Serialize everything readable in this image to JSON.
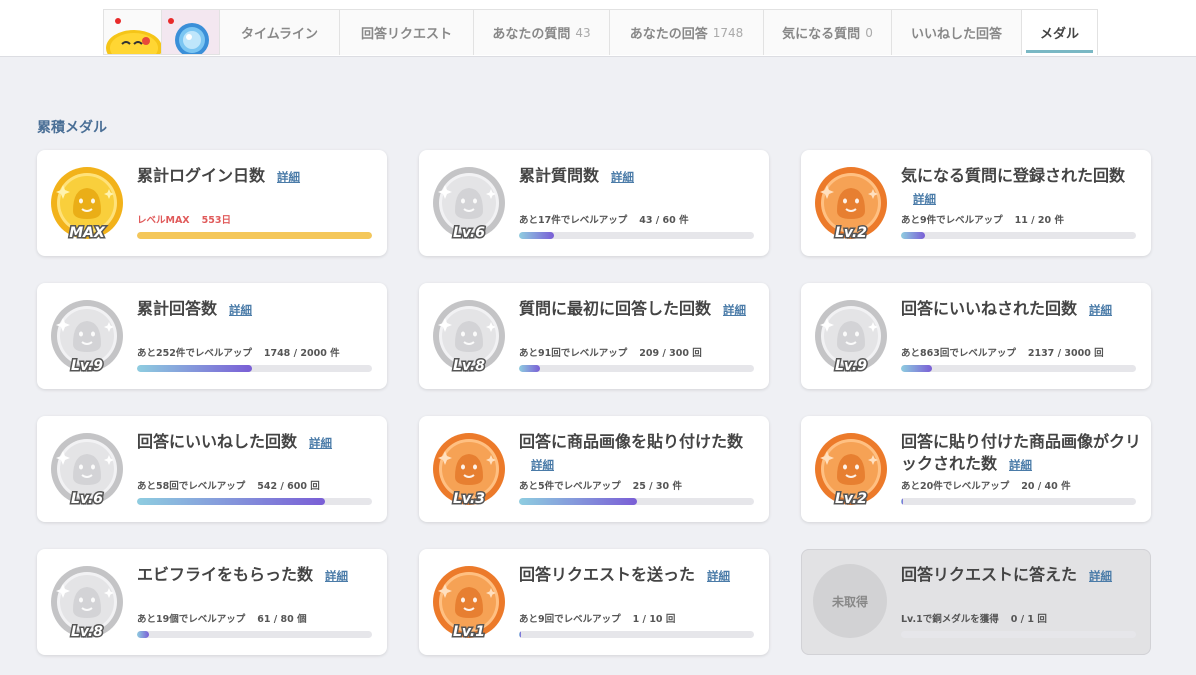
{
  "nav": {
    "avatars": [
      {
        "icon": "yellow-character-avatar"
      },
      {
        "icon": "blue-character-avatar"
      }
    ],
    "tabs": [
      {
        "label": "タイムライン",
        "count": ""
      },
      {
        "label": "回答リクエスト",
        "count": ""
      },
      {
        "label": "あなたの質問",
        "count": "43"
      },
      {
        "label": "あなたの回答",
        "count": "1748"
      },
      {
        "label": "気になる質問",
        "count": "0"
      },
      {
        "label": "いいねした回答",
        "count": ""
      },
      {
        "label": "メダル",
        "count": "",
        "active": true
      }
    ]
  },
  "section_title": "累積メダル",
  "detail_label": "詳細",
  "medals": [
    {
      "title": "累計ログイン日数",
      "tier": "gold",
      "level": "MAX",
      "progress_text": "レベルMAX",
      "progress_nums": "553日",
      "progress": 1.0,
      "max": true
    },
    {
      "title": "累計質問数",
      "tier": "silver",
      "level": "Lv.6",
      "progress_text": "あと17件でレベルアップ",
      "progress_nums": "43 / 60 件",
      "progress": 0.15
    },
    {
      "title": "気になる質問に登録された回数",
      "tier": "bronze",
      "level": "Lv.2",
      "progress_text": "あと9件でレベルアップ",
      "progress_nums": "11 / 20 件",
      "progress": 0.1
    },
    {
      "title": "累計回答数",
      "tier": "silver",
      "level": "Lv.9",
      "progress_text": "あと252件でレベルアップ",
      "progress_nums": "1748 / 2000 件",
      "progress": 0.49
    },
    {
      "title": "質問に最初に回答した回数",
      "tier": "silver",
      "level": "Lv.8",
      "progress_text": "あと91回でレベルアップ",
      "progress_nums": "209 / 300 回",
      "progress": 0.09
    },
    {
      "title": "回答にいいねされた回数",
      "tier": "silver",
      "level": "Lv.9",
      "progress_text": "あと863回でレベルアップ",
      "progress_nums": "2137 / 3000 回",
      "progress": 0.13
    },
    {
      "title": "回答にいいねした回数",
      "tier": "silver",
      "level": "Lv.6",
      "progress_text": "あと58回でレベルアップ",
      "progress_nums": "542 / 600 回",
      "progress": 0.8
    },
    {
      "title": "回答に商品画像を貼り付けた数",
      "tier": "bronze",
      "level": "Lv.3",
      "progress_text": "あと5件でレベルアップ",
      "progress_nums": "25 / 30 件",
      "progress": 0.5
    },
    {
      "title": "回答に貼り付けた商品画像がクリックされた数",
      "tier": "bronze",
      "level": "Lv.2",
      "progress_text": "あと20件でレベルアップ",
      "progress_nums": "20 / 40 件",
      "progress": 0.01
    },
    {
      "title": "エビフライをもらった数",
      "tier": "silver",
      "level": "Lv.8",
      "progress_text": "あと19個でレベルアップ",
      "progress_nums": "61 / 80 個",
      "progress": 0.05
    },
    {
      "title": "回答リクエストを送った",
      "tier": "bronze",
      "level": "Lv.1",
      "progress_text": "あと9回でレベルアップ",
      "progress_nums": "1 / 10 回",
      "progress": 0.01
    },
    {
      "title": "回答リクエストに答えた",
      "tier": "locked",
      "level": "",
      "locked_label": "未取得",
      "progress_text": "Lv.1で銅メダルを獲得",
      "progress_nums": "0 / 1 回",
      "progress": 0.0
    }
  ]
}
